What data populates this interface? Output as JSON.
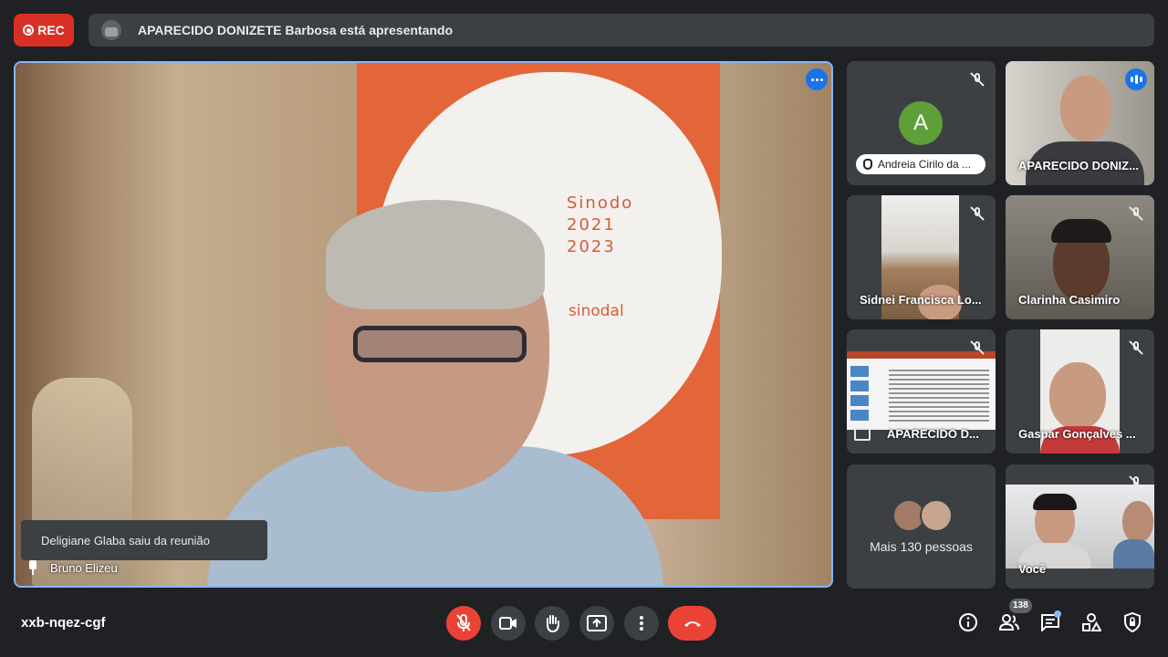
{
  "recording": {
    "label": "REC"
  },
  "presenting_banner": {
    "text": "APARECIDO DONIZETE Barbosa está apresentando"
  },
  "main_video": {
    "participant": "Bruno Elizeu",
    "toast": "Deligiane Glaba saiu da reunião",
    "banner_lines": [
      "Sinodo",
      "2021",
      "2023"
    ],
    "banner_word": "sinodal"
  },
  "tiles": [
    {
      "name": "Andreia Cirilo da ...",
      "initial": "A",
      "muted": true,
      "hand_raised": true
    },
    {
      "name": "APARECIDO DONIZ...",
      "speaking": true
    },
    {
      "name": "Sidnei Francisca Lo...",
      "muted": true
    },
    {
      "name": "Clarinha Casimiro",
      "muted": true
    },
    {
      "name": "APARECIDO D...",
      "muted": true,
      "presentation": true
    },
    {
      "name": "Gaspar Gonçalves ...",
      "muted": true
    },
    {
      "name": "Você",
      "muted": true
    }
  ],
  "more_people": {
    "label": "Mais 130 pessoas"
  },
  "meeting_code": "xxb-nqez-cgf",
  "participants_count": "138",
  "colors": {
    "accent_blue": "#1a73e8",
    "danger_red": "#ea4335",
    "surface": "#3c4043",
    "background": "#202124"
  }
}
